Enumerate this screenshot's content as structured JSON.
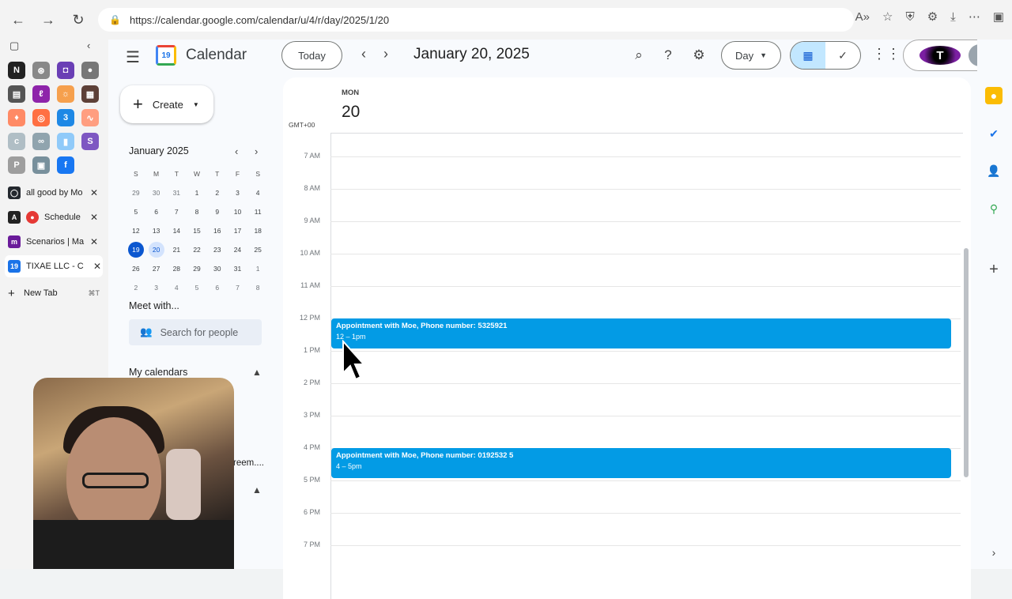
{
  "browser": {
    "url": "https://calendar.google.com/calendar/u/4/r/day/2025/1/20",
    "tabs": [
      {
        "label": "all good by Mo",
        "icon": "github-icon",
        "color": "#24292f"
      },
      {
        "label": "Schedule",
        "icon": "record-icon",
        "color": "#e53935"
      },
      {
        "label": "Scenarios | Ma",
        "icon": "make-icon",
        "color": "#6a1b9a"
      },
      {
        "label": "TIXAE LLC - C",
        "icon": "calendar-icon",
        "color": "#1a73e8"
      }
    ],
    "new_tab": {
      "label": "New Tab",
      "shortcut": "⌘T"
    }
  },
  "app": {
    "title": "Calendar",
    "today_label": "Today",
    "date_title": "January 20, 2025",
    "view_label": "Day",
    "create_label": "Create",
    "logo_day": "19"
  },
  "mini_calendar": {
    "month": "January 2025",
    "dow": [
      "S",
      "M",
      "T",
      "W",
      "T",
      "F",
      "S"
    ],
    "weeks": [
      [
        "29",
        "30",
        "31",
        "1",
        "2",
        "3",
        "4"
      ],
      [
        "5",
        "6",
        "7",
        "8",
        "9",
        "10",
        "11"
      ],
      [
        "12",
        "13",
        "14",
        "15",
        "16",
        "17",
        "18"
      ],
      [
        "19",
        "20",
        "21",
        "22",
        "23",
        "24",
        "25"
      ],
      [
        "26",
        "27",
        "28",
        "29",
        "30",
        "31",
        "1"
      ],
      [
        "2",
        "3",
        "4",
        "5",
        "6",
        "7",
        "8"
      ]
    ]
  },
  "sidebar": {
    "meet_with": "Meet with...",
    "search_people": "Search for people",
    "my_calendars": "My calendars",
    "partial_text": "reem...."
  },
  "day_view": {
    "dow": "MON",
    "day": "20",
    "timezone": "GMT+00",
    "hours": [
      "7 AM",
      "8 AM",
      "9 AM",
      "10 AM",
      "11 AM",
      "12 PM",
      "1 PM",
      "2 PM",
      "3 PM",
      "4 PM",
      "5 PM",
      "6 PM",
      "7 PM"
    ],
    "events": [
      {
        "title": "Appointment with Moe, Phone number: 5325921",
        "time": "12 – 1pm",
        "color": "#039be5"
      },
      {
        "title": "Appointment with Moe, Phone number: 0192532 5",
        "time": "4 – 5pm",
        "color": "#039be5"
      }
    ]
  }
}
